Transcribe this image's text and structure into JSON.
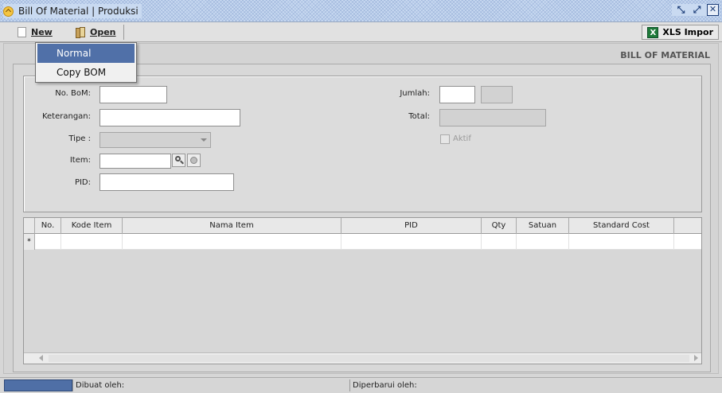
{
  "window": {
    "title": "Bill Of Material | Produksi",
    "controls": [
      "minimize-icon",
      "maximize-icon",
      "close-icon"
    ]
  },
  "toolbar": {
    "new_label": "New",
    "open_label": "Open",
    "xls_icon_text": "X",
    "xls_label": "XLS Impor"
  },
  "menu": {
    "items": [
      {
        "label": "Normal",
        "selected": true
      },
      {
        "label": "Copy BOM",
        "selected": false
      }
    ]
  },
  "form": {
    "title": "BILL OF MATERIAL",
    "no_bom_label": "No. BoM:",
    "keterangan_label": "Keterangan:",
    "tipe_label": "Tipe :",
    "item_label": "Item:",
    "pid_label": "PID:",
    "jumlah_label": "Jumlah:",
    "total_label": "Total:",
    "aktif_label": "Aktif"
  },
  "table": {
    "columns": [
      "No.",
      "Kode Item",
      "Nama Item",
      "PID",
      "Qty",
      "Satuan",
      "Standard Cost"
    ],
    "new_row_marker": "*"
  },
  "statusbar": {
    "dibuat_label": "Dibuat oleh:",
    "diperbarui_label": "Diperbarui oleh:"
  },
  "colors": {
    "menu_selected": "#5070a8",
    "status_block": "#4f6fa6"
  }
}
